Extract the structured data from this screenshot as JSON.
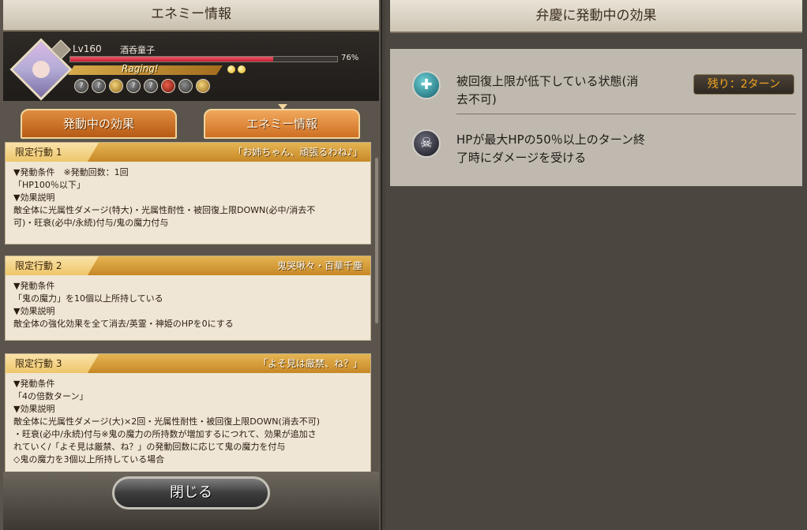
{
  "left": {
    "title": "エネミー情報",
    "enemy": {
      "level": "Lv160",
      "name": "酒呑童子",
      "hp_percent_text": "76%",
      "hp_fraction": 0.76,
      "status": "Raging!"
    },
    "tabs": [
      {
        "label": "発動中の効果"
      },
      {
        "label": "エネミー情報"
      }
    ],
    "actions": [
      {
        "tag": "限定行動 1",
        "name": "「お姉ちゃん、頑張るわね♪」",
        "lines": [
          "▼発動条件　※発動回数：1回",
          "「HP100％以下」",
          "▼効果説明",
          "敵全体に光属性ダメージ(特大)・光属性耐性・被回復上限DOWN(必中/消去不",
          "可)・旺衰(必中/永続)付与/鬼の魔力付与"
        ]
      },
      {
        "tag": "限定行動 2",
        "name": "鬼哭啾々・百華千塵",
        "lines": [
          "▼発動条件",
          "「鬼の魔力」を10個以上所持している",
          "▼効果説明",
          "敵全体の強化効果を全て消去/英霊・神姫のHPを0にする"
        ]
      },
      {
        "tag": "限定行動 3",
        "name": "「よそ見は厳禁、ね？」",
        "lines": [
          "▼発動条件",
          "「4の倍数ターン」",
          "▼効果説明",
          "敵全体に光属性ダメージ(大)×2回・光属性耐性・被回復上限DOWN(消去不可)",
          "・旺衰(必中/永続)付与※鬼の魔力の所持数が増加するにつれて、効果が追加さ",
          "れていく/「よそ見は厳禁、ね？」の発動回数に応じて鬼の魔力を付与",
          "◇鬼の魔力を3個以上所持している場合"
        ]
      }
    ],
    "close_label": "閉じる"
  },
  "right": {
    "title": "弁慶に発動中の効果",
    "effects": [
      {
        "text_line1": "被回復上限が低下している状態(消",
        "text_line2": "去不可)",
        "turns": "残り：2ターン",
        "icon": "heal-down-icon"
      },
      {
        "text_line1": "HPが最大HPの50％以上のターン終",
        "text_line2": "了時にダメージを受ける",
        "icon": "skull-icon"
      }
    ]
  }
}
